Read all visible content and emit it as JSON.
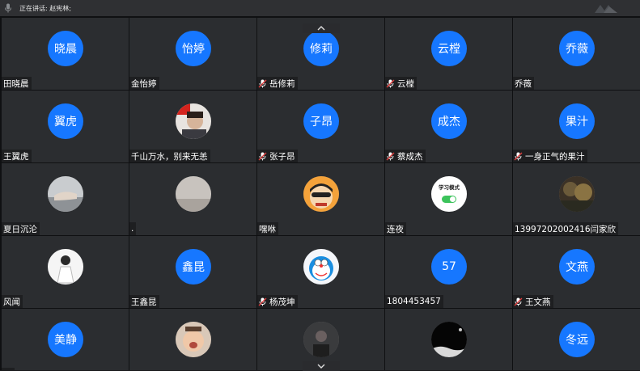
{
  "speaking_label": "正在讲话: 赵宪林;",
  "participants": [
    {
      "name": "田晓晨",
      "avatar_text": "晓晨",
      "muted": false
    },
    {
      "name": "金怡婷",
      "avatar_text": "怡婷",
      "muted": false
    },
    {
      "name": "岳修莉",
      "avatar_text": "修莉",
      "muted": true
    },
    {
      "name": "云樘",
      "avatar_text": "云樘",
      "muted": true
    },
    {
      "name": "乔薇",
      "avatar_text": "乔薇",
      "muted": false
    },
    {
      "name": "王翼虎",
      "avatar_text": "翼虎",
      "muted": false
    },
    {
      "name": "千山万水，别来无恙",
      "avatar_photo": "flag-portrait",
      "muted": false
    },
    {
      "name": "张子昂",
      "avatar_text": "子昂",
      "muted": true
    },
    {
      "name": "蔡成杰",
      "avatar_text": "成杰",
      "muted": true
    },
    {
      "name": "一身正气的果汁",
      "avatar_text": "果汁",
      "muted": true
    },
    {
      "name": "夏日沉沦",
      "avatar_photo": "hand-photo",
      "muted": false
    },
    {
      "name": ".",
      "avatar_photo": "sky-photo",
      "muted": false
    },
    {
      "name": "嘿咻",
      "avatar_photo": "cartoon-boy",
      "muted": false
    },
    {
      "name": "连夜",
      "avatar_photo": "study-mode",
      "avatar_caption": "学习模式",
      "muted": false
    },
    {
      "name": "13997202002416闫家欣",
      "avatar_photo": "forest-photo",
      "muted": false
    },
    {
      "name": "风闻",
      "avatar_photo": "figure-photo",
      "muted": false
    },
    {
      "name": "王鑫昆",
      "avatar_text": "鑫昆",
      "muted": false
    },
    {
      "name": "杨茂坤",
      "avatar_photo": "doraemon",
      "muted": true
    },
    {
      "name": "1804453457",
      "avatar_text": "57",
      "muted": false
    },
    {
      "name": "王文燕",
      "avatar_text": "文燕",
      "muted": true
    },
    {
      "name": "",
      "avatar_text": "美静",
      "muted": true
    },
    {
      "name": "",
      "avatar_photo": "baby-photo",
      "muted": false
    },
    {
      "name": "",
      "avatar_photo": "dark-portrait",
      "muted": false
    },
    {
      "name": "",
      "avatar_photo": "night-photo",
      "muted": false
    },
    {
      "name": "",
      "avatar_text": "冬远",
      "muted": false
    }
  ],
  "colors": {
    "avatar_blue": "#1677ff",
    "tile_bg": "#2b2d30",
    "grid_bg": "#0f1012",
    "muted_red": "#e03b3b"
  }
}
